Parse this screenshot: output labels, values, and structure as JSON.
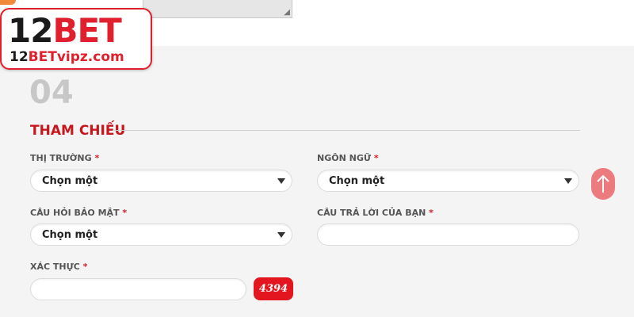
{
  "logo": {
    "main_prefix": "12",
    "main_suffix": "BET",
    "sub_prefix": "12",
    "sub_suffix": "BETvipz.com"
  },
  "section": {
    "step": "04",
    "title": "THAM CHIẾU"
  },
  "form": {
    "market": {
      "label": "THỊ TRƯỜNG",
      "required": "*",
      "selected": "Chọn một"
    },
    "language": {
      "label": "NGÔN NGỮ",
      "required": "*",
      "selected": "Chọn một"
    },
    "security_question": {
      "label": "CÂU HỎI BẢO MẬT",
      "required": "*",
      "selected": "Chọn một"
    },
    "security_answer": {
      "label": "CÂU TRẢ LỜI CỦA BẠN",
      "required": "*",
      "value": ""
    },
    "verification": {
      "label": "XÁC THỰC",
      "required": "*",
      "value": "",
      "captcha_code": "4394"
    }
  },
  "colors": {
    "accent": "#c8161d",
    "captcha_bg": "#e3161f",
    "scroll_button": "#ec7b7f"
  },
  "icons": {
    "caret": "caret-down-icon",
    "scroll_top": "arrow-up-icon"
  }
}
